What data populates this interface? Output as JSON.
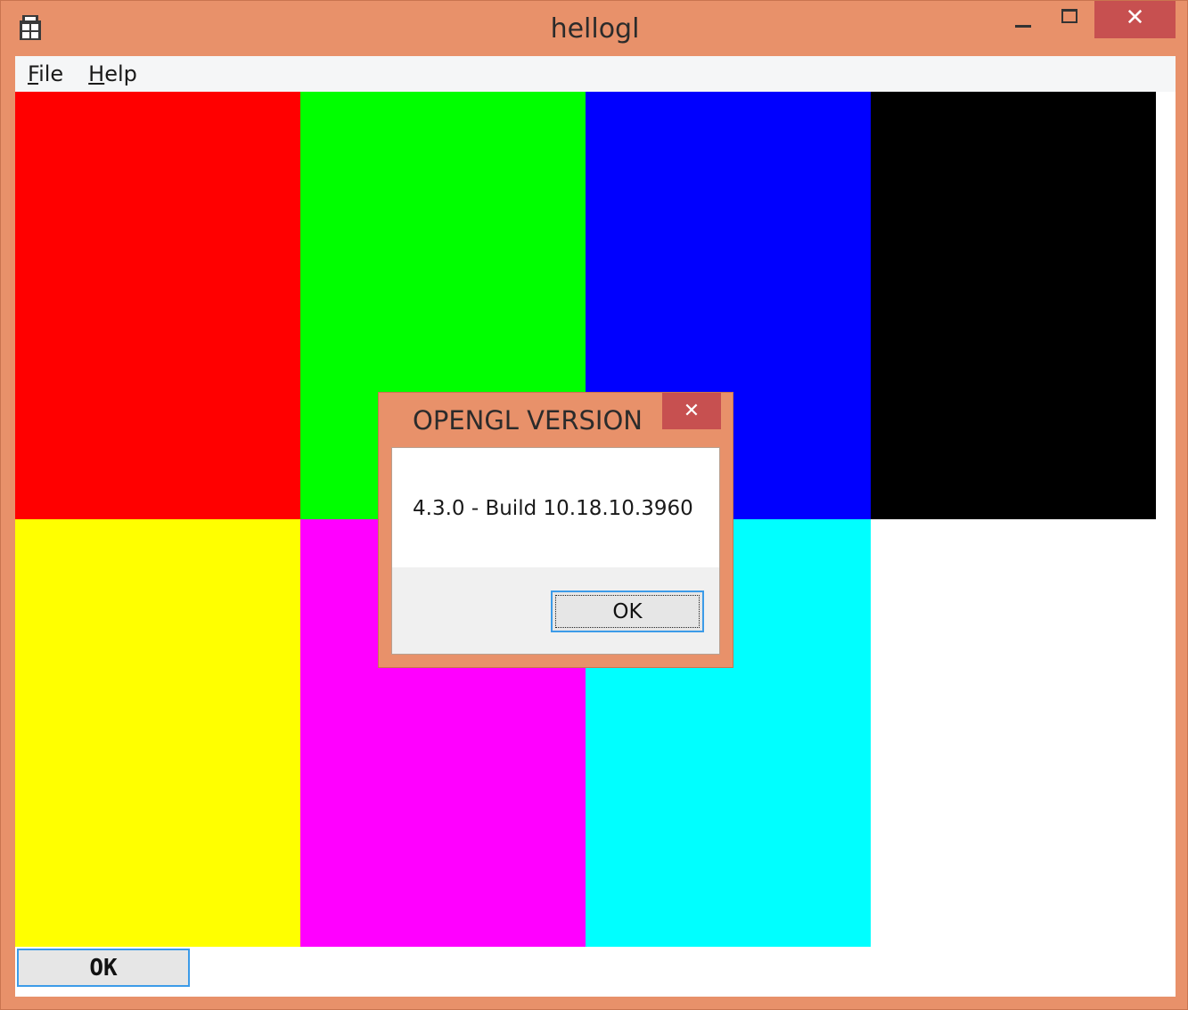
{
  "window": {
    "title": "hellogl",
    "close_glyph": "✕",
    "frame_color": "#e8916a",
    "close_color": "#c75050",
    "icon": "app-icon"
  },
  "menu": {
    "items": [
      {
        "accel": "F",
        "rest": "ile"
      },
      {
        "accel": "H",
        "rest": "elp"
      }
    ]
  },
  "canvas": {
    "colors": [
      "#ff0000",
      "#00ff00",
      "#0000ff",
      "#000000",
      "#ffff00",
      "#ff00ff",
      "#00ffff"
    ]
  },
  "main_ok_button": {
    "label": "OK"
  },
  "dialog": {
    "title": "OPENGL VERSION",
    "close_glyph": "✕",
    "message": "4.3.0 - Build 10.18.10.3960",
    "ok_label": "OK"
  }
}
